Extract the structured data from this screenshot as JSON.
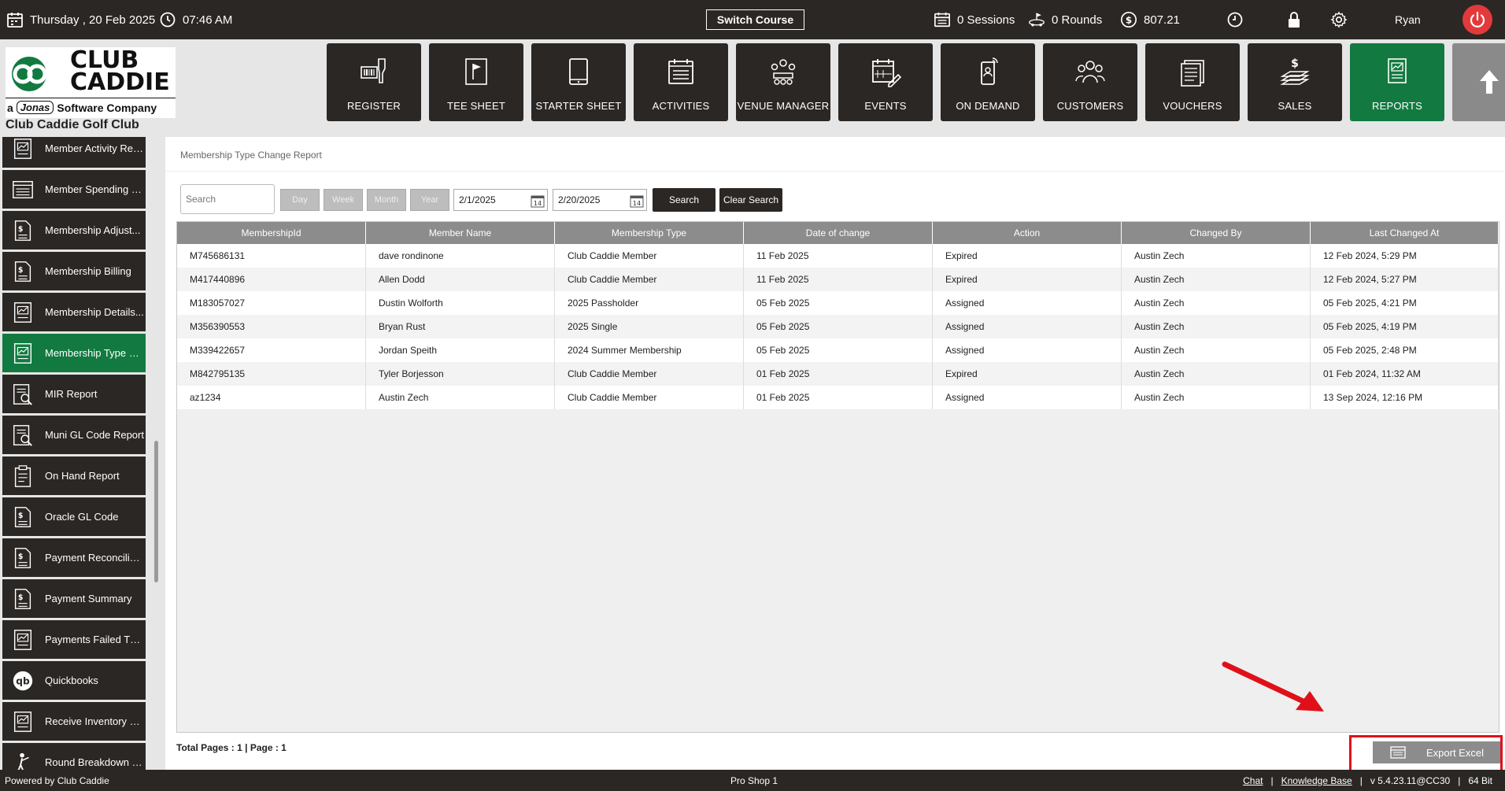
{
  "topbar": {
    "date": "Thursday ,  20 Feb 2025",
    "time": "07:46 AM",
    "switch_course": "Switch Course",
    "sessions": "0 Sessions",
    "rounds": "0 Rounds",
    "balance": "807.21",
    "user": "Ryan"
  },
  "logo": {
    "line1": "CLUB",
    "line2": "CADDIE",
    "tagline_prefix": "a",
    "tagline_brand": "Jonas",
    "tagline_suffix": "Software Company",
    "club_name": "Club Caddie Golf Club"
  },
  "modules": [
    {
      "label": "REGISTER",
      "icon": "barcode-scanner-icon"
    },
    {
      "label": "TEE SHEET",
      "icon": "flag-icon"
    },
    {
      "label": "STARTER SHEET",
      "icon": "tablet-icon"
    },
    {
      "label": "ACTIVITIES",
      "icon": "calendar-list-icon"
    },
    {
      "label": "VENUE MANAGER",
      "icon": "meeting-icon"
    },
    {
      "label": "EVENTS",
      "icon": "calendar-edit-icon"
    },
    {
      "label": "ON DEMAND",
      "icon": "mobile-icon"
    },
    {
      "label": "CUSTOMERS",
      "icon": "users-icon"
    },
    {
      "label": "VOUCHERS",
      "icon": "voucher-icon"
    },
    {
      "label": "SALES",
      "icon": "sales-icon"
    },
    {
      "label": "REPORTS",
      "icon": "report-icon"
    }
  ],
  "sidebar": {
    "items": [
      {
        "label": "Member Activity Rep...",
        "icon": "chart-doc-icon"
      },
      {
        "label": "Member Spending R...",
        "icon": "list-doc-icon"
      },
      {
        "label": "Membership Adjust...",
        "icon": "dollar-doc-icon"
      },
      {
        "label": "Membership Billing",
        "icon": "dollar-doc-icon"
      },
      {
        "label": "Membership Details...",
        "icon": "chart-doc-icon"
      },
      {
        "label": "Membership Type C...",
        "icon": "chart-doc-icon"
      },
      {
        "label": "MIR Report",
        "icon": "search-doc-icon"
      },
      {
        "label": "Muni GL Code Report",
        "icon": "search-doc-icon"
      },
      {
        "label": "On Hand Report",
        "icon": "clipboard-icon"
      },
      {
        "label": "Oracle GL Code",
        "icon": "dollar-doc-icon"
      },
      {
        "label": "Payment Reconciliati...",
        "icon": "dollar-doc-icon"
      },
      {
        "label": "Payment Summary",
        "icon": "dollar-doc-icon"
      },
      {
        "label": "Payments Failed Thr...",
        "icon": "chart-doc-icon"
      },
      {
        "label": "Quickbooks",
        "icon": "quickbooks-icon"
      },
      {
        "label": "Receive Inventory Re...",
        "icon": "chart-doc-icon"
      },
      {
        "label": "Round Breakdown R...",
        "icon": "golfer-icon"
      }
    ],
    "active_index": 5
  },
  "report": {
    "title": "Membership Type Change Report",
    "search_placeholder": "Search",
    "range_buttons": [
      "Day",
      "Week",
      "Month",
      "Year"
    ],
    "date_from": "2/1/2025",
    "date_to": "2/20/2025",
    "calendar_day": "14",
    "search_button": "Search",
    "clear_button": "Clear Search",
    "columns": [
      "MembershipId",
      "Member Name",
      "Membership Type",
      "Date of change",
      "Action",
      "Changed By",
      "Last Changed At"
    ],
    "rows": [
      [
        "M745686131",
        "dave rondinone",
        "Club Caddie Member",
        "11 Feb 2025",
        "Expired",
        "Austin Zech",
        "12 Feb 2024, 5:29 PM"
      ],
      [
        "M417440896",
        "Allen Dodd",
        "Club Caddie Member",
        "11 Feb 2025",
        "Expired",
        "Austin Zech",
        "12 Feb 2024, 5:27 PM"
      ],
      [
        "M183057027",
        "Dustin Wolforth",
        "2025 Passholder",
        "05 Feb 2025",
        "Assigned",
        "Austin Zech",
        "05 Feb 2025, 4:21 PM"
      ],
      [
        "M356390553",
        "Bryan Rust",
        "2025 Single",
        "05 Feb 2025",
        "Assigned",
        "Austin Zech",
        "05 Feb 2025, 4:19 PM"
      ],
      [
        "M339422657",
        "Jordan Speith",
        "2024 Summer Membership",
        "05 Feb 2025",
        "Assigned",
        "Austin Zech",
        "05 Feb 2025, 2:48 PM"
      ],
      [
        "M842795135",
        "Tyler Borjesson",
        "Club Caddie Member",
        "01 Feb 2025",
        "Expired",
        "Austin Zech",
        "01 Feb 2024, 11:32 AM"
      ],
      [
        "az1234",
        "Austin Zech",
        "Club Caddie Member",
        "01 Feb 2025",
        "Assigned",
        "Austin Zech",
        "13 Sep 2024, 12:16 PM"
      ]
    ],
    "pager": "Total Pages : 1 | Page : 1",
    "export_button": "Export Excel"
  },
  "footer": {
    "powered_by": "Powered by Club Caddie",
    "location": "Pro Shop 1",
    "chat": "Chat",
    "sep": "|",
    "knowledge_base": "Knowledge Base",
    "version": "v 5.4.23.11@CC30",
    "bits": "64 Bit"
  },
  "colors": {
    "dark": "#2b2724",
    "active_green": "#127a40",
    "header_gray": "#8c8c8c",
    "highlight_red": "#e0101a",
    "power_red": "#e23a3a"
  }
}
